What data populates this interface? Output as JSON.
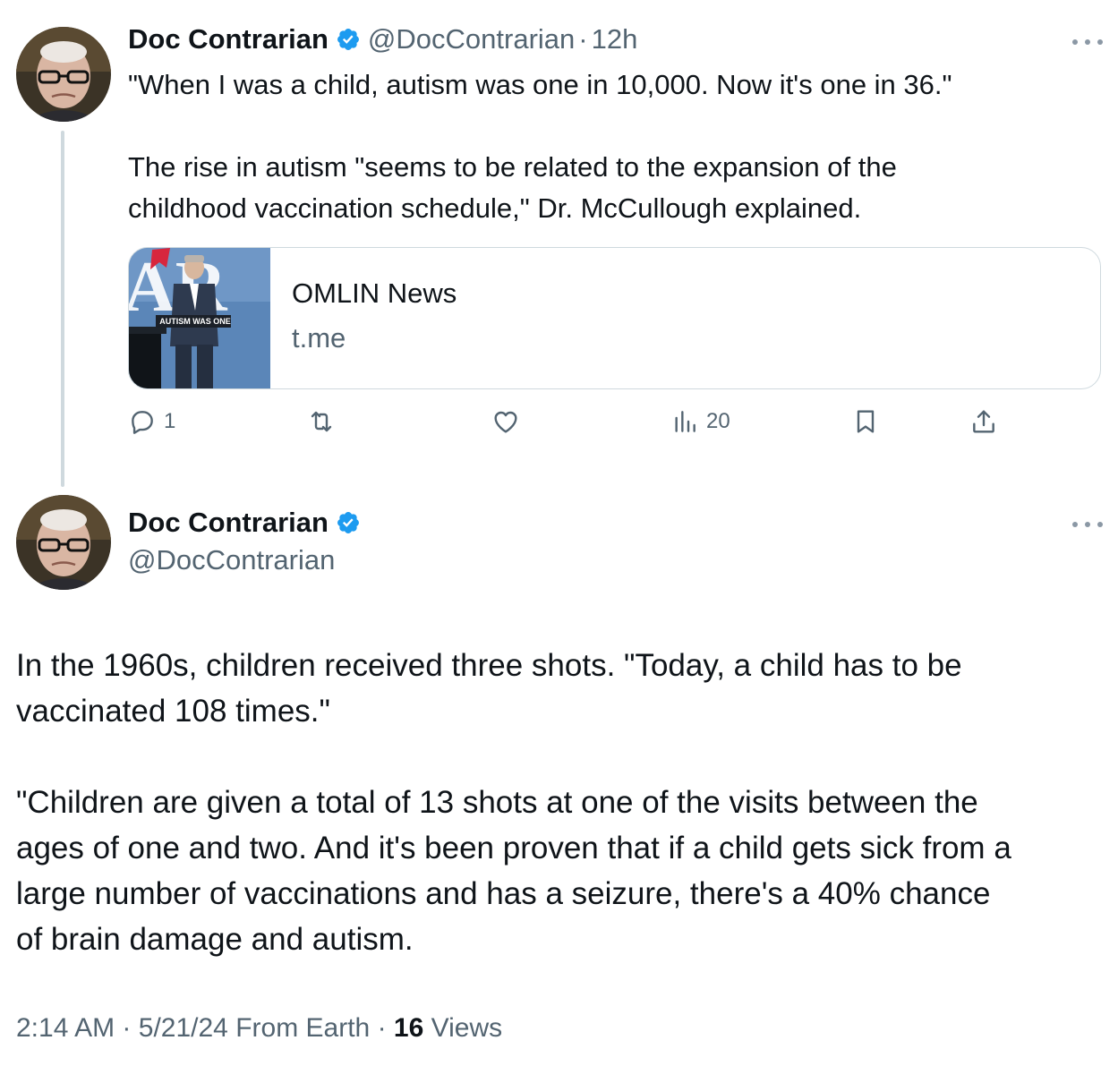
{
  "colors": {
    "verified_badge": "#1d9bf0",
    "secondary_text": "#536471",
    "primary_text": "#0f1419",
    "thread_line": "#cfd9de"
  },
  "tweet1": {
    "display_name": "Doc Contrarian",
    "handle": "@DocContrarian",
    "separator": "·",
    "time": "12h",
    "text": "\"When I was a child, autism was one in 10,000. Now it's one in 36.\"\n\nThe rise in autism \"seems to be related to the expansion of the\nchildhood vaccination schedule,\" Dr. McCullough explained.",
    "card": {
      "title": "OMLIN News",
      "domain": "t.me",
      "thumbnail_caption": "AUTISM WAS ONE"
    },
    "actions": {
      "reply_icon": "reply-icon",
      "reply_count": "1",
      "retweet_icon": "retweet-icon",
      "like_icon": "heart-icon",
      "views_icon": "views-icon",
      "views_count": "20",
      "bookmark_icon": "bookmark-icon",
      "share_icon": "share-icon"
    }
  },
  "tweet2": {
    "display_name": "Doc Contrarian",
    "handle": "@DocContrarian",
    "text": "In the 1960s, children received three shots. \"Today, a child has to be\nvaccinated 108 times.\"\n\n\"Children are given a total of 13 shots at one of the visits between the\nages of one and two. And it's been proven that if a child gets sick from a\nlarge number of vaccinations and has a seizure, there's a 40% chance\nof brain damage and autism.",
    "meta": {
      "time": "2:14 AM",
      "sep1": "·",
      "date": "5/21/24",
      "source": "From Earth",
      "sep2": "·",
      "views_count": "16",
      "views_label": "Views"
    }
  }
}
